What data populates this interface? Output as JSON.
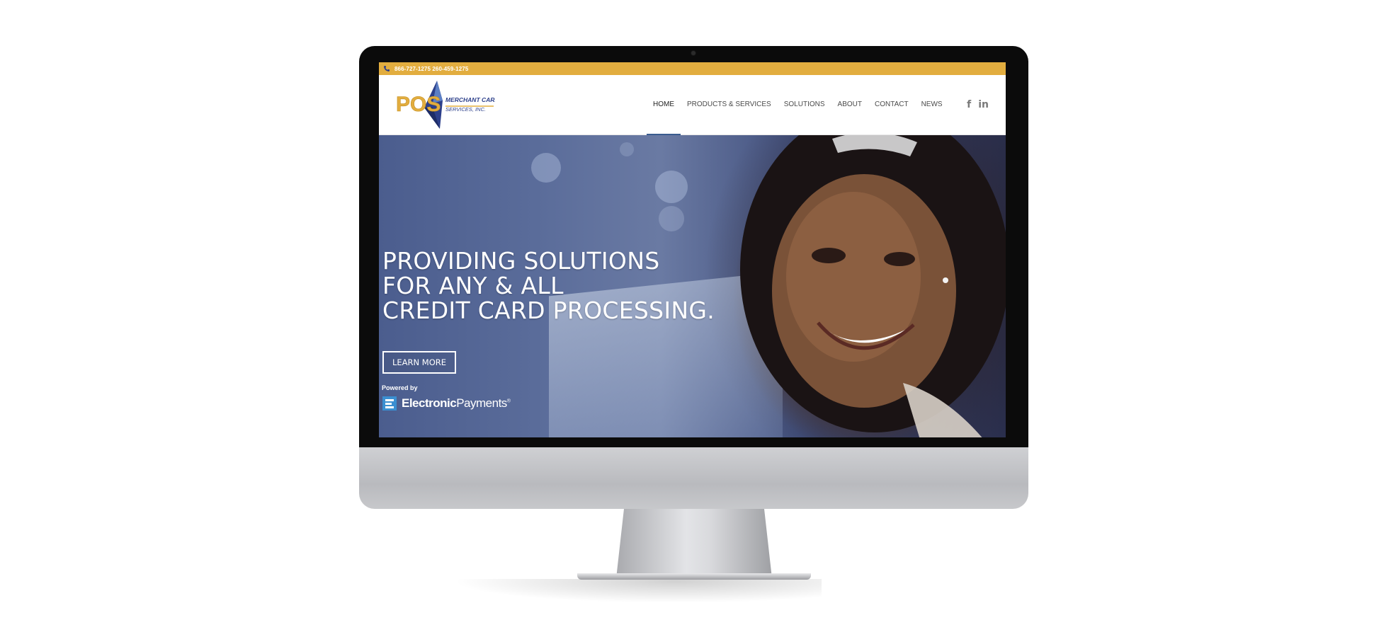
{
  "topbar": {
    "phones": "866-727-1275  260-459-1275"
  },
  "logo": {
    "mark": "POS",
    "line1": "MERCHANT CARD",
    "line2": "SERVICES, INC."
  },
  "nav": {
    "items": [
      {
        "label": "HOME"
      },
      {
        "label": "PRODUCTS & SERVICES"
      },
      {
        "label": "SOLUTIONS"
      },
      {
        "label": "ABOUT"
      },
      {
        "label": "CONTACT"
      },
      {
        "label": "NEWS"
      }
    ],
    "active": "HOME"
  },
  "social": {
    "facebook": "f",
    "linkedin": "in"
  },
  "hero": {
    "title_lines": [
      "PROVIDING SOLUTIONS",
      "FOR ANY & ALL",
      "CREDIT CARD PROCESSING."
    ],
    "button_label": "LEARN MORE",
    "powered_by": "Powered by",
    "partner_bold": "Electronic",
    "partner_light": "Payments",
    "partner_tm": "®"
  },
  "colors": {
    "topbar": "#e2ad3f",
    "logo_gold": "#e2ad3f",
    "logo_blue": "#2c3f8a",
    "nav_active_underline": "#3a5c8f"
  },
  "icons": [
    "phone-icon",
    "facebook-icon",
    "linkedin-icon",
    "electronic-payments-icon"
  ]
}
